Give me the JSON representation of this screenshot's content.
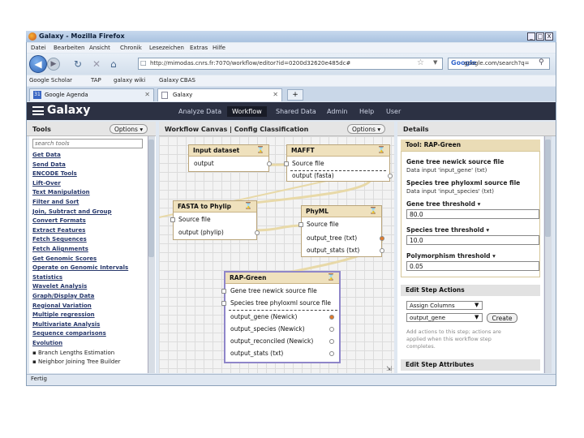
{
  "window": {
    "title": "Galaxy - Mozilla Firefox",
    "controls": [
      "_",
      "□",
      "X"
    ]
  },
  "menubar": [
    "Datei",
    "Bearbeiten",
    "Ansicht",
    "Chronik",
    "Lesezeichen",
    "Extras",
    "Hilfe"
  ],
  "navbar": {
    "url": "http://mimodas.cnrs.fr:7070/workflow/editor?id=0200d32620e485dc#",
    "search_value": "google.com/search?q=",
    "search_engine": "Google"
  },
  "bookmarks": [
    "Google Scholar",
    "TAP",
    "galaxy wiki",
    "Galaxy",
    "CBAS"
  ],
  "browser_tabs": [
    {
      "label": "Google Agenda",
      "icon": "calendar-icon"
    },
    {
      "label": "Galaxy",
      "icon": "page-icon"
    }
  ],
  "galaxy": {
    "brand": "Galaxy",
    "nav": [
      "Analyze Data",
      "Workflow",
      "Shared Data",
      "Admin",
      "Help",
      "User"
    ],
    "active_nav": "Workflow"
  },
  "tools_panel": {
    "title": "Tools",
    "options_label": "Options ▾",
    "search_placeholder": "search tools",
    "links": [
      "Get Data",
      "Send Data",
      "ENCODE Tools",
      "Lift-Over",
      "Text Manipulation",
      "Filter and Sort",
      "Join, Subtract and Group",
      "Convert Formats",
      "Extract Features",
      "Fetch Sequences",
      "Fetch Alignments",
      "Get Genomic Scores",
      "Operate on Genomic Intervals",
      "Statistics",
      "Wavelet Analysis",
      "Graph/Display Data",
      "Regional Variation",
      "Multiple regression",
      "Multivariate Analysis",
      "Sequence comparisons"
    ],
    "section": "Evolution",
    "sub_items": [
      "Branch Lengths Estimation",
      "Neighbor Joining Tree Builder"
    ]
  },
  "canvas": {
    "title": "Workflow Canvas | Config Classification",
    "options_label": "Options ▾",
    "nodes": {
      "input_dataset": {
        "title": "Input dataset",
        "outputs": [
          "output"
        ]
      },
      "mafft": {
        "title": "MAFFT",
        "inputs": [
          "Source file"
        ],
        "outputs": [
          "output (fasta)"
        ]
      },
      "fasta_to_phylip": {
        "title": "FASTA to Phylip",
        "inputs": [
          "Source file"
        ],
        "outputs": [
          "output (phylip)"
        ]
      },
      "phyml": {
        "title": "PhyML",
        "inputs": [
          "Source file"
        ],
        "outputs": [
          "output_tree (txt)",
          "output_stats (txt)"
        ]
      },
      "rap_green": {
        "title": "RAP-Green",
        "inputs": [
          "Gene tree newick source file",
          "Species tree phyloxml source file"
        ],
        "outputs": [
          "output_gene (Newick)",
          "output_species (Newick)",
          "output_reconciled (Newick)",
          "output_stats (txt)"
        ]
      }
    }
  },
  "details": {
    "title": "Details",
    "tool_header": "Tool: RAP-Green",
    "fields": [
      {
        "label": "Gene tree newick source file",
        "sub": "Data input 'input_gene' (txt)"
      },
      {
        "label": "Species tree phyloxml source file",
        "sub": "Data input 'input_species' (txt)"
      }
    ],
    "params": [
      {
        "label": "Gene tree threshold ▾",
        "value": "80.0"
      },
      {
        "label": "Species tree threshold ▾",
        "value": "10.0"
      },
      {
        "label": "Polymorphism threshold ▾",
        "value": "0.05"
      }
    ],
    "edit_actions": {
      "header": "Edit Step Actions",
      "action_select": "Assign Columns",
      "output_select": "output_gene",
      "create_label": "Create",
      "help": [
        "Add actions to this step; actions are",
        "applied when this workflow step",
        "completes."
      ]
    },
    "attributes_header": "Edit Step Attributes"
  },
  "status": "Fertig",
  "colors": {
    "galaxy_bar": "#2c3143",
    "node_header": "#efe1bd",
    "selected_node": "#8f86c9",
    "link": "#27386b"
  }
}
